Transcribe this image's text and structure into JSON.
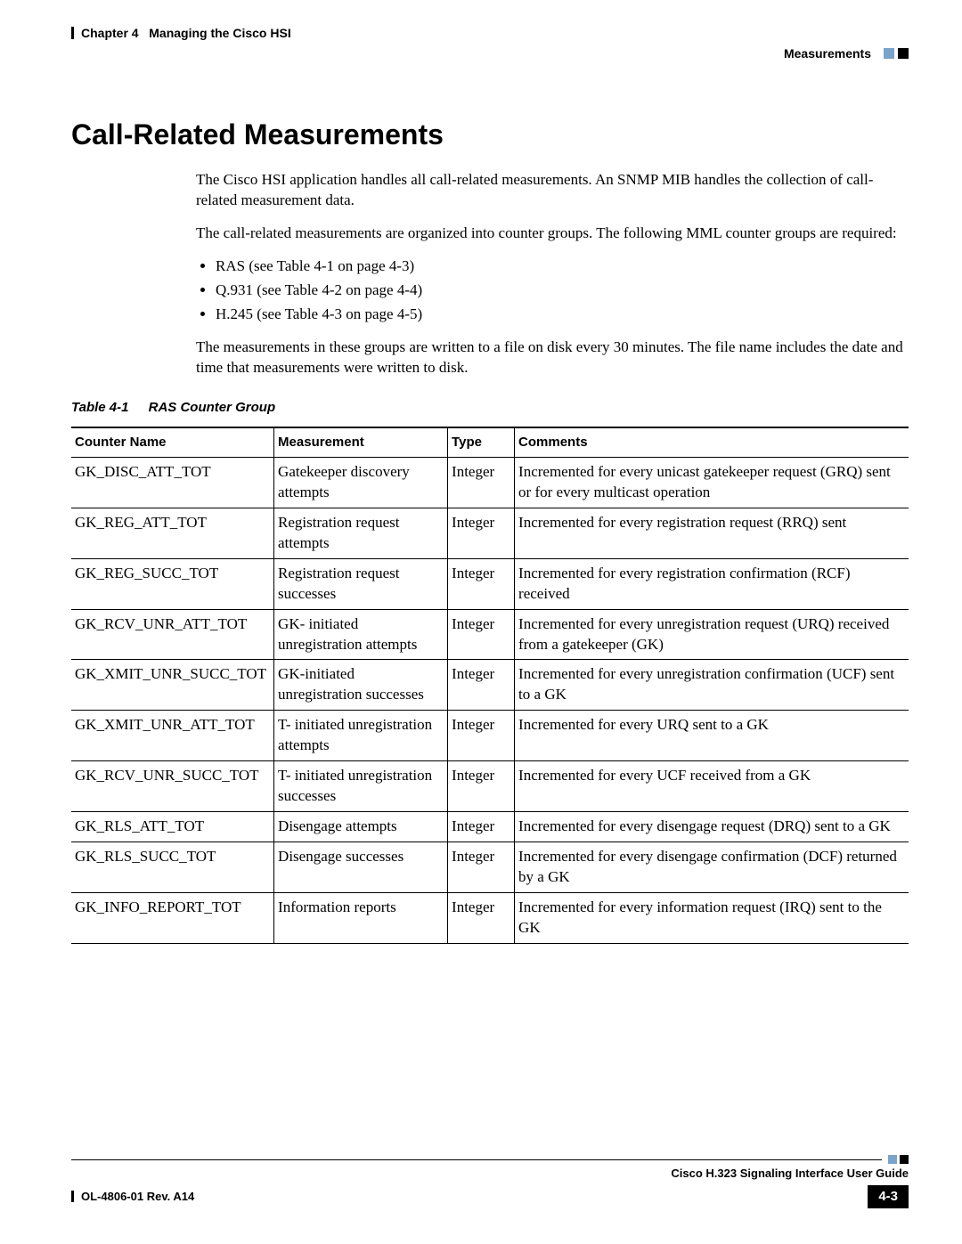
{
  "header": {
    "chapter_label": "Chapter 4",
    "chapter_title": "Managing the Cisco HSI",
    "section": "Measurements"
  },
  "h1": "Call-Related Measurements",
  "intro": {
    "p1": "The Cisco HSI application handles all call-related measurements. An SNMP MIB handles the collection of call-related measurement data.",
    "p2": "The call-related measurements are organized into counter groups. The following MML counter groups are required:",
    "bullets": [
      "RAS (see Table 4-1 on page 4-3)",
      "Q.931 (see Table 4-2 on page 4-4)",
      "H.245 (see Table 4-3 on page 4-5)"
    ],
    "p3": "The measurements in these groups are written to a file on disk every 30 minutes. The file name includes the date and time that measurements were written to disk."
  },
  "table": {
    "caption_number": "Table 4-1",
    "caption_title": "RAS Counter Group",
    "headers": {
      "counter": "Counter Name",
      "measurement": "Measurement",
      "type": "Type",
      "comments": "Comments"
    },
    "rows": [
      {
        "counter": "GK_DISC_ATT_TOT",
        "measurement": "Gatekeeper discovery attempts",
        "type": "Integer",
        "comments": "Incremented for every unicast gatekeeper request (GRQ) sent or for every multicast operation"
      },
      {
        "counter": "GK_REG_ATT_TOT",
        "measurement": "Registration request attempts",
        "type": "Integer",
        "comments": "Incremented for every registration request (RRQ) sent"
      },
      {
        "counter": "GK_REG_SUCC_TOT",
        "measurement": "Registration request successes",
        "type": "Integer",
        "comments": "Incremented for every registration confirmation (RCF) received"
      },
      {
        "counter": "GK_RCV_UNR_ATT_TOT",
        "measurement": "GK- initiated unregistration attempts",
        "type": "Integer",
        "comments": "Incremented for every unregistration request (URQ) received from a gatekeeper (GK)"
      },
      {
        "counter": "GK_XMIT_UNR_SUCC_TOT",
        "measurement": "GK-initiated unregistration successes",
        "type": "Integer",
        "comments": "Incremented for every unregistration confirmation (UCF) sent to a GK"
      },
      {
        "counter": "GK_XMIT_UNR_ATT_TOT",
        "measurement": "T- initiated unregistration attempts",
        "type": "Integer",
        "comments": "Incremented for every URQ sent to a GK"
      },
      {
        "counter": "GK_RCV_UNR_SUCC_TOT",
        "measurement": "T- initiated unregistration successes",
        "type": "Integer",
        "comments": "Incremented for every UCF received from a GK"
      },
      {
        "counter": "GK_RLS_ATT_TOT",
        "measurement": "Disengage attempts",
        "type": "Integer",
        "comments": "Incremented for every disengage request (DRQ) sent to a GK"
      },
      {
        "counter": "GK_RLS_SUCC_TOT",
        "measurement": "Disengage successes",
        "type": "Integer",
        "comments": "Incremented for every disengage confirmation (DCF) returned by a GK"
      },
      {
        "counter": "GK_INFO_REPORT_TOT",
        "measurement": "Information reports",
        "type": "Integer",
        "comments": "Incremented for every information request (IRQ) sent to the GK"
      }
    ]
  },
  "footer": {
    "book_title": "Cisco H.323 Signaling Interface User Guide",
    "doc_id": "OL-4806-01 Rev. A14",
    "page_number": "4-3"
  }
}
